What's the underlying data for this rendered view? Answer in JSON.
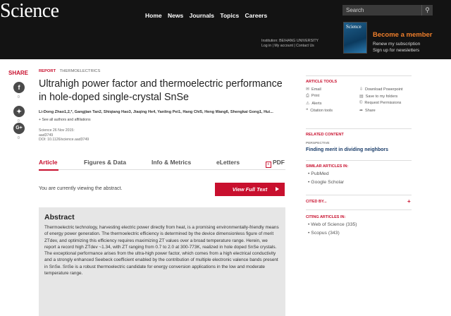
{
  "header": {
    "logo": "Science",
    "nav": [
      "Home",
      "News",
      "Journals",
      "Topics",
      "Careers"
    ],
    "search_placeholder": "Search",
    "institution_line1": "Institution: BEIHANG UNIVERSITY",
    "institution_line2": "Log in | My account | Contact Us",
    "cover_title": "Science",
    "become_member": "Become a member",
    "renew": "Renew my subscription",
    "signup": "Sign up for newsletters"
  },
  "share": {
    "label": "SHARE",
    "facebook_count": "0",
    "twitter_count": "0",
    "google_count": "0"
  },
  "article": {
    "report": "REPORT",
    "topic": "THERMOELECTRICS",
    "title": "Ultrahigh power factor and thermoelectric performance in hole-doped single-crystal SnSe",
    "authors": "Li-Dong Zhao1,2,*, Gangjian Tan2, Shiqiang Hao3, Jiaqing He4, Yanling Pei1, Hang Chi5, Heng Wang6, Shengkai Gong1, Hui...",
    "see_all": "+ See all authors and affiliations",
    "meta_line1": "Science  26 Nov 2015:",
    "meta_line2": "aad3749",
    "meta_line3": "DOI: 10.1126/science.aad3749"
  },
  "tabs": {
    "article": "Article",
    "figures": "Figures & Data",
    "info": "Info & Metrics",
    "eletters": "eLetters",
    "pdf": "PDF"
  },
  "viewing": "You are currently viewing the abstract.",
  "view_full_text": "View Full Text",
  "abstract": {
    "heading": "Abstract",
    "text": "Thermoelectric technology, harvesting electric power directly from heat, is a promising environmentally-friendly means of energy power generation. The thermoelectric efficiency is determined by the device dimensionless figure of merit ZTdev, and optimizing this efficiency requires maximizing ZT values over a broad temperature range. Herein, we report a record high ZTdev ~1.34, with ZT ranging from 0.7 to 2.0 at 300-773K, realized in hole doped SnSe crystals. The exceptional performance arises from the ultra-high power factor, which comes from a high electrical conductivity and a strongly enhanced Seebeck coefficient enabled by the contribution of multiple electronic valence bands present in SnSe. SnSe is a robust thermoelectric candidate for energy conversion applications in the low and moderate temperature range."
  },
  "sidebar": {
    "tools_heading": "ARTICLE TOOLS",
    "tools_left": [
      "Email",
      "Print",
      "Alerts",
      "Citation tools"
    ],
    "tools_right": [
      "Download Powerpoint",
      "Save to my folders",
      "Request Permissions",
      "Share"
    ],
    "related_heading": "RELATED CONTENT",
    "perspective": "PERSPECTIVE",
    "related_title": "Finding merit in dividing neighbors",
    "similar_heading": "SIMILAR ARTICLES IN:",
    "similar": [
      "PubMed",
      "Google Scholar"
    ],
    "cited_heading": "CITED BY...",
    "citing_heading": "CITING ARTICLES IN:",
    "citing": [
      "Web of Science (335)",
      "Scopus (343)"
    ]
  }
}
